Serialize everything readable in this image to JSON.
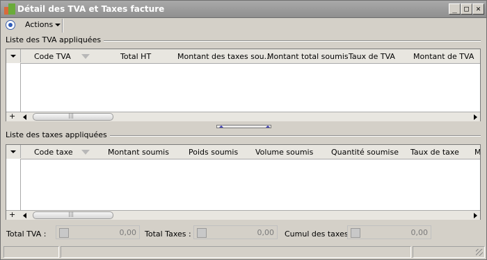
{
  "window": {
    "title": "Détail des TVA et Taxes facture",
    "controls": {
      "minimize": "_",
      "maximize": "□",
      "close": "✕"
    }
  },
  "toolbar": {
    "actions_label": "Actions",
    "actions_icon": "radio-icon"
  },
  "tva_section": {
    "label": "Liste des TVA appliquées",
    "columns": [
      "Code TVA",
      "Total HT",
      "Montant des taxes sou...",
      "Montant total soumis",
      "Taux de TVA",
      "Montant de TVA"
    ],
    "rows": [],
    "footer_add": "+"
  },
  "taxes_section": {
    "label": "Liste des taxes appliquées",
    "columns": [
      "Code taxe",
      "Montant soumis",
      "Poids soumis",
      "Volume soumis",
      "Quantité soumise",
      "Taux de taxe",
      "M"
    ],
    "rows": [],
    "footer_add": "+"
  },
  "totals": {
    "total_tva_label": "Total TVA :",
    "total_tva_value": "0,00",
    "total_taxes_label": "Total Taxes :",
    "total_taxes_value": "0,00",
    "cumul_label": "Cumul des taxes :",
    "cumul_value": "0,00"
  },
  "colors": {
    "titlebar": "#999999",
    "window_bg": "#d4d0c8",
    "grid_bg": "#ffffff",
    "accent": "#2e5bb8"
  }
}
